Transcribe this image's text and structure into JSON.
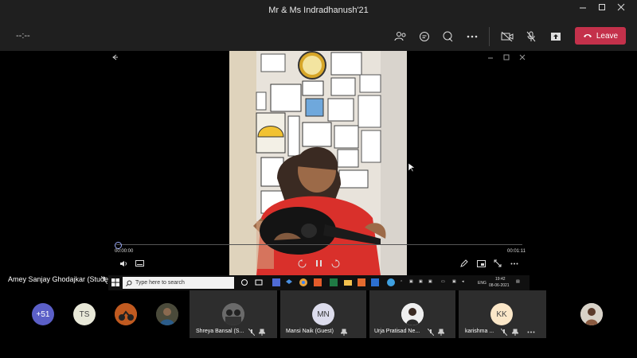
{
  "window": {
    "title": "Mr & Ms Indradhanush'21",
    "controls": [
      "minimize",
      "maximize",
      "close"
    ]
  },
  "toolbar": {
    "timer": "--:--",
    "icons": [
      "people-icon",
      "chat-icon",
      "reactions-icon",
      "more-icon",
      "camera-off-icon",
      "mic-off-icon",
      "share-icon"
    ],
    "leave_label": "Leave",
    "leave_color": "#c4314b"
  },
  "player": {
    "current_time": "00:00:00",
    "total_time": "00:01:11",
    "progress": 0.0
  },
  "speaker": {
    "name": "Amey Sanjay Ghodajkar (Student)"
  },
  "taskbar": {
    "search_placeholder": "Type here to search",
    "lang": "ENG",
    "clock_time": "19:42",
    "clock_date": "08-06-2021"
  },
  "participants": {
    "overflow_count": "+51",
    "circles": [
      {
        "initials": "TS"
      },
      {
        "initials": ""
      },
      {
        "initials": ""
      }
    ],
    "gallery": [
      {
        "name": "Shreya Bansal (S...",
        "initials": ""
      },
      {
        "name": "Mansi Naik (Guest)",
        "initials": "MN"
      },
      {
        "name": "Urja Pratisad Ne...",
        "initials": ""
      },
      {
        "name": "karishma ...",
        "initials": "KK"
      }
    ]
  }
}
